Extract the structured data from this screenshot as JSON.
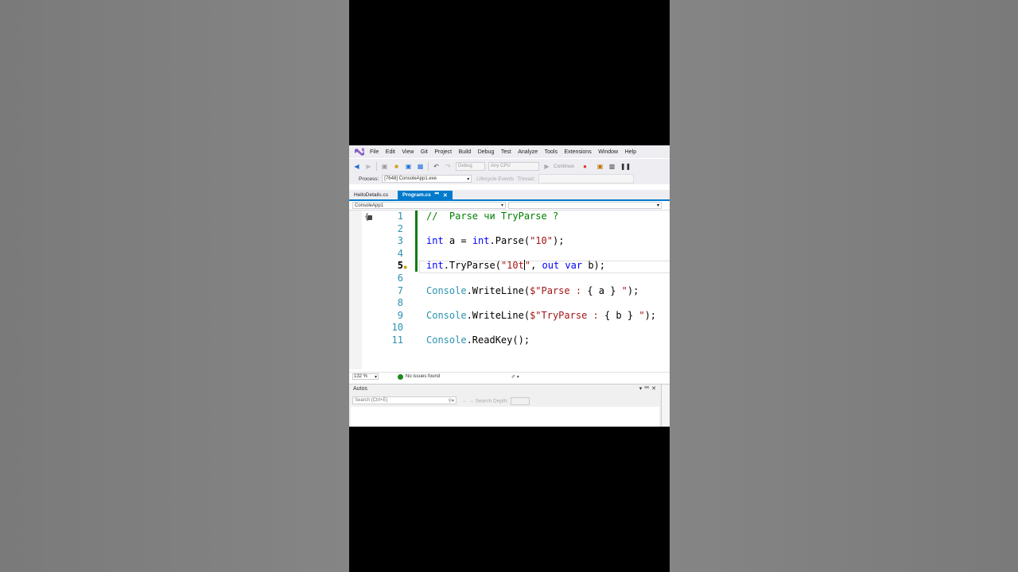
{
  "menu": [
    "File",
    "Edit",
    "View",
    "Git",
    "Project",
    "Build",
    "Debug",
    "Test",
    "Analyze",
    "Tools",
    "Extensions",
    "Window",
    "Help"
  ],
  "toolbar": {
    "config": "Debug",
    "platform": "Any CPU",
    "continue_label": "Continue"
  },
  "process": {
    "label": "Process:",
    "value": "[7648] ConsoleApp1.exe",
    "lifecycle": "Lifecycle Events",
    "thread": "Thread:"
  },
  "tabs": [
    {
      "label": "HelloDetails.cs",
      "active": false
    },
    {
      "label": "Program.cs",
      "active": true
    }
  ],
  "nav": {
    "project": "ConsoleApp1"
  },
  "editor": {
    "line_numbers": [
      "1",
      "2",
      "3",
      "4",
      "5",
      "6",
      "7",
      "8",
      "9",
      "10",
      "11"
    ],
    "current_line": 5,
    "lines": {
      "l1_comment": "//  Parse чи TryParse ?",
      "l3_kw1": "int",
      "l3_rest1": " a = ",
      "l3_kw2": "int",
      "l3_rest2": ".Parse(",
      "l3_str": "\"10\"",
      "l3_end": ");",
      "l5_kw": "int",
      "l5_rest": ".TryParse(",
      "l5_str": "\"10t",
      "l5_str2": "\"",
      "l5_kw2": "out var",
      "l5_end": " b);",
      "l7_type": "Console",
      "l7_call": ".WriteLine(",
      "l7_str1": "$\"Parse : ",
      "l7_interp": "{ a }",
      "l7_str2": " \"",
      "l7_end": ");",
      "l9_type": "Console",
      "l9_call": ".WriteLine(",
      "l9_str1": "$\"TryParse : ",
      "l9_interp": "{ b }",
      "l9_str2": " \"",
      "l9_end": ");",
      "l11_type": "Console",
      "l11_call": ".ReadKey();"
    }
  },
  "status": {
    "zoom": "132 %",
    "issues": "No issues found"
  },
  "autos": {
    "title": "Autos",
    "search_placeholder": "Search (Ctrl+E)",
    "search_depth": "Search Depth:"
  },
  "colors": {
    "accent": "#007acc",
    "change_bar": "#107c10",
    "keyword": "#0000ff",
    "comment": "#008000",
    "string": "#a31515",
    "type": "#2b91af"
  }
}
